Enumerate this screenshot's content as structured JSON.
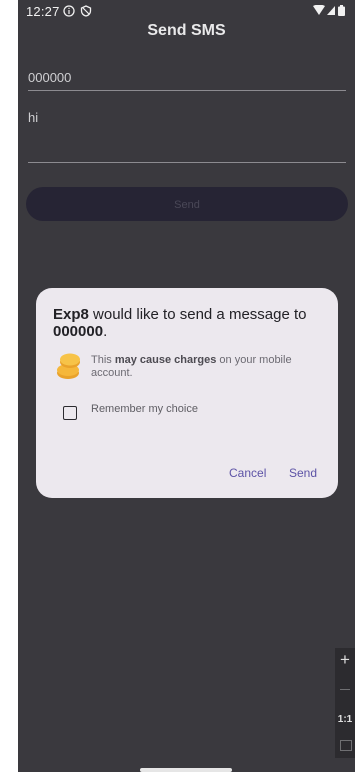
{
  "status_bar": {
    "time": "12:27",
    "icons": [
      "info-icon",
      "shield-icon",
      "wifi-icon",
      "signal-icon",
      "battery-icon"
    ]
  },
  "app": {
    "title": "Send SMS",
    "phone_value": "000000",
    "message_value": "hi",
    "send_label": "Send"
  },
  "dialog": {
    "app_name": "Exp8",
    "title_middle": " would like to send a message to ",
    "recipient": "000000",
    "title_end": ".",
    "charge_prefix": "This ",
    "charge_bold": "may cause charges",
    "charge_suffix": " on your mobile account.",
    "remember_label": "Remember my choice",
    "cancel_label": "Cancel",
    "send_label": "Send"
  },
  "zoom": {
    "plus": "+",
    "ratio": "1:1"
  },
  "colors": {
    "accent": "#5d53a6",
    "dialog_bg": "#ece8ee",
    "screen_bg": "#3a393e"
  }
}
